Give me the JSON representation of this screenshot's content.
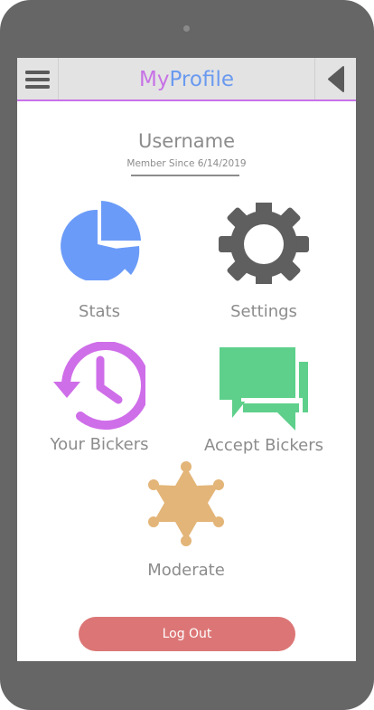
{
  "header": {
    "title_my": "My",
    "title_profile": "Profile",
    "menu_icon": "hamburger-menu-icon",
    "back_icon": "back-arrow-icon"
  },
  "profile": {
    "username": "Username",
    "member_since": "Member Since 6/14/2019"
  },
  "menu_tiles": [
    {
      "label": "Stats",
      "icon": "pie-chart-icon",
      "color": "#6b9bf8"
    },
    {
      "label": "Settings",
      "icon": "gear-icon",
      "color": "#5f5f5f"
    },
    {
      "label": "Your Bickers",
      "icon": "history-clock-icon",
      "color": "#cf6ee9"
    },
    {
      "label": "Accept Bickers",
      "icon": "chat-bubbles-icon",
      "color": "#5ed08b"
    },
    {
      "label": "Moderate",
      "icon": "sheriff-star-icon",
      "color": "#e3b578"
    }
  ],
  "logout": {
    "label": "Log Out",
    "color": "#dc7676"
  },
  "colors": {
    "device_frame": "#666666",
    "topbar_bg": "#e3e3e3",
    "topbar_accent": "#c872e8",
    "title_my": "#c772e6",
    "title_profile": "#6a9af0",
    "text_gray": "#8c8c8c"
  }
}
